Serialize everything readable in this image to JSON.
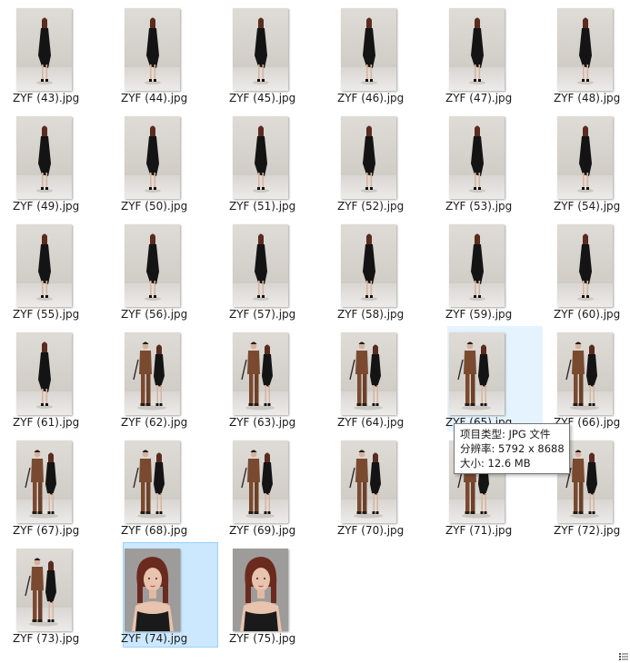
{
  "files": [
    {
      "name": "ZYF (43).jpg",
      "kind": "woman"
    },
    {
      "name": "ZYF (44).jpg",
      "kind": "woman"
    },
    {
      "name": "ZYF (45).jpg",
      "kind": "woman"
    },
    {
      "name": "ZYF (46).jpg",
      "kind": "woman"
    },
    {
      "name": "ZYF (47).jpg",
      "kind": "woman"
    },
    {
      "name": "ZYF (48).jpg",
      "kind": "woman"
    },
    {
      "name": "ZYF (49).jpg",
      "kind": "woman"
    },
    {
      "name": "ZYF (50).jpg",
      "kind": "woman"
    },
    {
      "name": "ZYF (51).jpg",
      "kind": "woman"
    },
    {
      "name": "ZYF (52).jpg",
      "kind": "woman"
    },
    {
      "name": "ZYF (53).jpg",
      "kind": "woman"
    },
    {
      "name": "ZYF (54).jpg",
      "kind": "woman"
    },
    {
      "name": "ZYF (55).jpg",
      "kind": "woman"
    },
    {
      "name": "ZYF (56).jpg",
      "kind": "woman"
    },
    {
      "name": "ZYF (57).jpg",
      "kind": "woman"
    },
    {
      "name": "ZYF (58).jpg",
      "kind": "woman"
    },
    {
      "name": "ZYF (59).jpg",
      "kind": "woman"
    },
    {
      "name": "ZYF (60).jpg",
      "kind": "woman"
    },
    {
      "name": "ZYF (61).jpg",
      "kind": "woman"
    },
    {
      "name": "ZYF (62).jpg",
      "kind": "couple"
    },
    {
      "name": "ZYF (63).jpg",
      "kind": "couple"
    },
    {
      "name": "ZYF (64).jpg",
      "kind": "couple"
    },
    {
      "name": "ZYF (65).jpg",
      "kind": "couple",
      "state": "hover"
    },
    {
      "name": "ZYF (66).jpg",
      "kind": "couple"
    },
    {
      "name": "ZYF (67).jpg",
      "kind": "couple"
    },
    {
      "name": "ZYF (68).jpg",
      "kind": "couple"
    },
    {
      "name": "ZYF (69).jpg",
      "kind": "couple"
    },
    {
      "name": "ZYF (70).jpg",
      "kind": "couple"
    },
    {
      "name": "ZYF (71).jpg",
      "kind": "couple"
    },
    {
      "name": "ZYF (72).jpg",
      "kind": "couple"
    },
    {
      "name": "ZYF (73).jpg",
      "kind": "couple"
    },
    {
      "name": "ZYF (74).jpg",
      "kind": "portrait",
      "state": "selected"
    },
    {
      "name": "ZYF (75).jpg",
      "kind": "portrait"
    }
  ],
  "tooltip": {
    "type_line": "项目类型: JPG 文件",
    "dimensions_line": "分辨率: 5792 x 8688",
    "size_line": "大小: 12.6 MB"
  },
  "colors": {
    "hover_bg": "#e5f3ff",
    "selected_bg": "#cce8ff",
    "selected_border": "#99d1ff"
  }
}
